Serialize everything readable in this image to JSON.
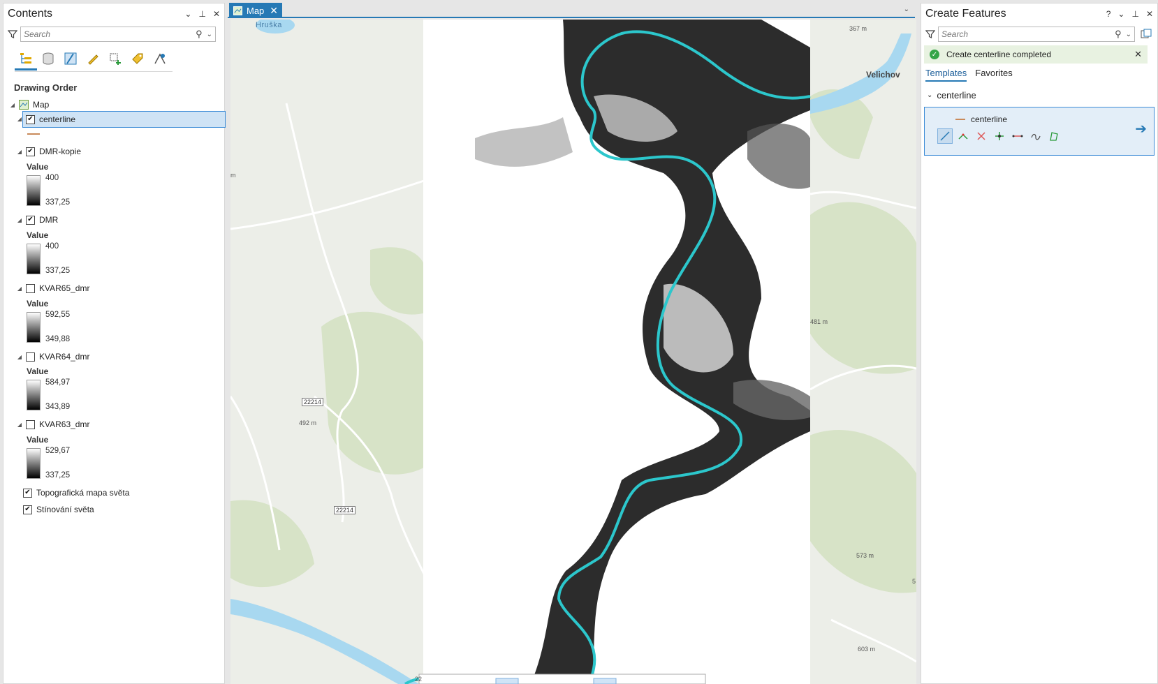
{
  "contents": {
    "title": "Contents",
    "controls": {
      "dropdown": "⌄",
      "pin": "⊥",
      "close": "✕"
    },
    "search": {
      "placeholder": "Search"
    },
    "toolbar_icons": [
      "list-by-drawing-order-icon",
      "list-by-source-icon",
      "list-by-selection-icon",
      "list-by-editing-icon",
      "list-by-snapping-icon",
      "list-by-labeling-icon",
      "list-by-perspective-icon"
    ],
    "section_title": "Drawing Order",
    "map_name": "Map",
    "layers": [
      {
        "name": "centerline",
        "checked": true,
        "selected": true,
        "type": "line"
      },
      {
        "name": "DMR-kopie",
        "checked": true,
        "legend_label": "Value",
        "high": "400",
        "low": "337,25"
      },
      {
        "name": "DMR",
        "checked": true,
        "legend_label": "Value",
        "high": "400",
        "low": "337,25"
      },
      {
        "name": "KVAR65_dmr",
        "checked": false,
        "legend_label": "Value",
        "high": "592,55",
        "low": "349,88"
      },
      {
        "name": "KVAR64_dmr",
        "checked": false,
        "legend_label": "Value",
        "high": "584,97",
        "low": "343,89"
      },
      {
        "name": "KVAR63_dmr",
        "checked": false,
        "legend_label": "Value",
        "high": "529,67",
        "low": "337,25"
      },
      {
        "name": "Topografická mapa světa",
        "checked": true
      },
      {
        "name": "Stínování světa",
        "checked": true
      }
    ]
  },
  "map_view": {
    "tab_label": "Map",
    "close": "✕",
    "labels": {
      "hruska": "Hruška",
      "velichov": "Velichov",
      "elev_367": "367 m",
      "elev_481": "481 m",
      "elev_492": "492 m",
      "elev_573": "573 m",
      "elev_603": "603 m",
      "road_1": "22214",
      "road_2": "22214",
      "left_m": "m",
      "right_5": "5",
      "bottom_22": "22"
    },
    "colors": {
      "centerline": "#2cc7cc",
      "water": "#a8d8f0",
      "vegetation": "#d7e3c7",
      "background": "#eceee8"
    }
  },
  "create_features": {
    "title": "Create Features",
    "controls": {
      "help": "?",
      "dropdown": "⌄",
      "pin": "⊥",
      "close": "✕"
    },
    "search": {
      "placeholder": "Search"
    },
    "status": "Create centerline completed",
    "tabs": [
      "Templates",
      "Favorites"
    ],
    "group": "centerline",
    "template": "centerline",
    "tools": [
      "line-tool-icon",
      "right-angle-line-icon",
      "direction-distance-icon",
      "midpoint-icon",
      "endpoint-arc-icon",
      "trace-icon",
      "stream-icon"
    ]
  }
}
